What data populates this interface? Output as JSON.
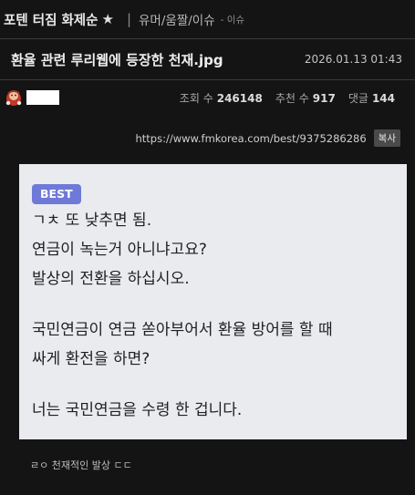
{
  "board": {
    "title": "포텐 터짐 화제순",
    "star_icon": "star-icon",
    "categories": "유머/움짤/이슈",
    "subcategory": "- 이슈"
  },
  "post": {
    "title": "환율 관련 루리웹에 등장한 천재.jpg",
    "date": "2026.01.13 01:43",
    "views_label": "조회 수",
    "views": "246148",
    "recommends_label": "추천 수",
    "recommends": "917",
    "comments_label": "댓글",
    "comments": "144",
    "url": "https://www.fmkorea.com/best/9375286286",
    "copy_label": "복사"
  },
  "image": {
    "badge": "BEST",
    "badge_color": "#6f79d8",
    "paragraph1": [
      "ㄱㅊ 또 낮추면 됨.",
      "연금이 녹는거 아니냐고요?",
      "발상의 전환을 하십시오."
    ],
    "paragraph2": [
      "국민연금이 연금 쏟아부어서 환율 방어를 할 때",
      "싸게 환전을 하면?"
    ],
    "paragraph3": [
      "너는 국민연금을 수령 한 겁니다."
    ]
  },
  "body_text": "ㄹㅇ 천재적인 발상 ㄷㄷ"
}
